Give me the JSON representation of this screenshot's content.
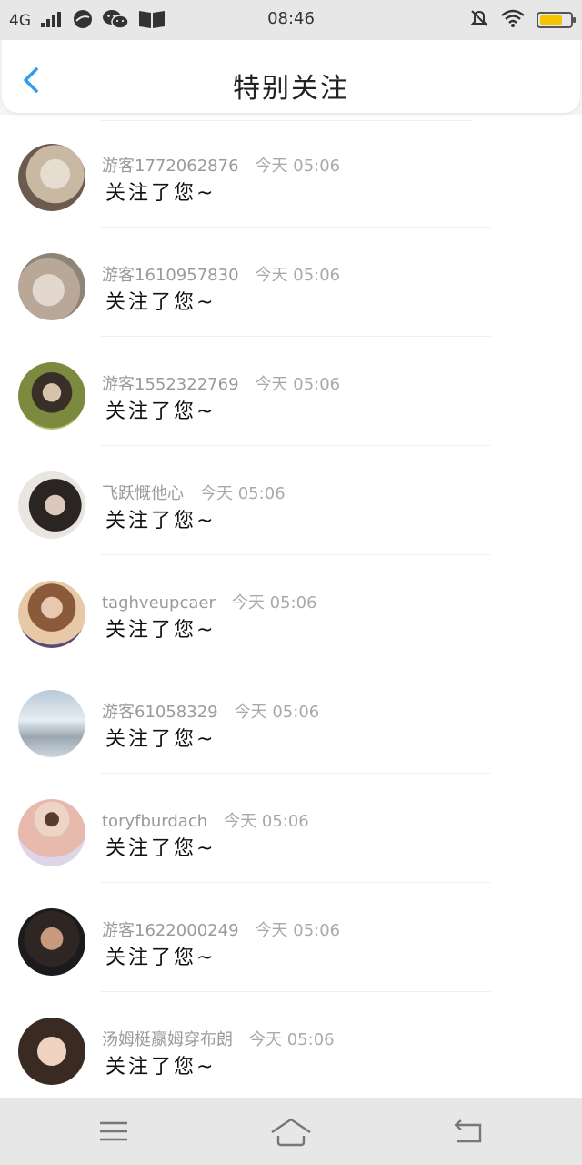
{
  "status_bar": {
    "network": "4G",
    "time": "08:46",
    "icons": [
      "signal-icon",
      "app-icon",
      "wechat-icon",
      "book-icon",
      "mute-icon",
      "wifi-icon",
      "battery-icon"
    ],
    "battery_level": 0.75,
    "battery_color": "#f5c400"
  },
  "header": {
    "title": "特别关注",
    "back_icon": "chevron-left-icon",
    "accent": "#2f9cf0"
  },
  "items": [
    {
      "name": "游客1772062876",
      "time": "今天 05:06",
      "message": "关注了您~"
    },
    {
      "name": "游客1610957830",
      "time": "今天 05:06",
      "message": "关注了您~"
    },
    {
      "name": "游客1552322769",
      "time": "今天 05:06",
      "message": "关注了您~"
    },
    {
      "name": "飞跃慨他心",
      "time": "今天 05:06",
      "message": "关注了您~"
    },
    {
      "name": "taghveupcaer",
      "time": "今天 05:06",
      "message": "关注了您~"
    },
    {
      "name": "游客61058329",
      "time": "今天 05:06",
      "message": "关注了您~"
    },
    {
      "name": "toryfburdach",
      "time": "今天 05:06",
      "message": "关注了您~"
    },
    {
      "name": "游客1622000249",
      "time": "今天 05:06",
      "message": "关注了您~"
    },
    {
      "name": "汤姆梃嬴姆穿布朗",
      "time": "今天 05:06",
      "message": "关注了您~"
    }
  ],
  "nav_bar": {
    "icons": [
      "menu-icon",
      "home-icon",
      "back-icon"
    ]
  }
}
